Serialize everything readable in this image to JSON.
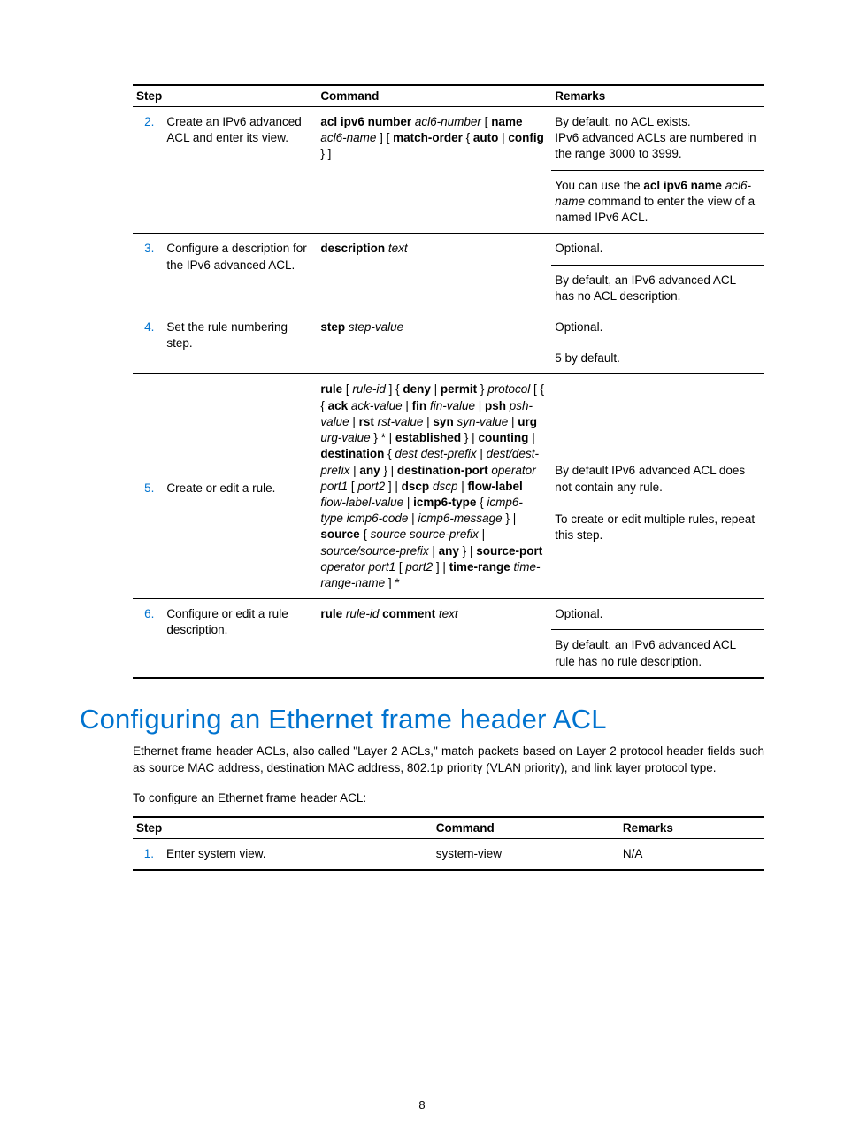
{
  "table1": {
    "headers": {
      "step": "Step",
      "command": "Command",
      "remarks": "Remarks"
    },
    "rows": [
      {
        "num": "2.",
        "step": "Create an IPv6 advanced ACL and enter its view.",
        "command_html": "<span class='b'>acl ipv6 number</span> <span class='i'>acl6-number</span> [ <span class='b'>name</span> <span class='i'>acl6-name</span> ] [ <span class='b'>match-order</span> { <span class='b'>auto</span> | <span class='b'>config</span> } ]",
        "remarks_html": [
          "By default, no ACL exists.<br>IPv6 advanced ACLs are numbered in the range 3000 to 3999.",
          "You can use the <span class='b'>acl ipv6 name</span> <span class='i'>acl6-name</span> command to enter the view of a named IPv6 ACL."
        ]
      },
      {
        "num": "3.",
        "step": "Configure a description for the IPv6 advanced ACL.",
        "command_html": "<span class='b'>description</span> <span class='i'>text</span>",
        "remarks_html": [
          "Optional.",
          "By default, an IPv6 advanced ACL has no ACL description."
        ]
      },
      {
        "num": "4.",
        "step": "Set the rule numbering step.",
        "command_html": "<span class='b'>step</span> <span class='i'>step-value</span>",
        "remarks_html": [
          "Optional.",
          "5 by default."
        ]
      },
      {
        "num": "5.",
        "step": "Create or edit a rule.",
        "command_html": "<span class='b'>rule</span> [ <span class='i'>rule-id</span> ] { <span class='b'>deny</span> | <span class='b'>permit</span> } <span class='i'>protocol</span> [ { { <span class='b'>ack</span> <span class='i'>ack-value</span> | <span class='b'>fin</span> <span class='i'>fin-value</span> | <span class='b'>psh</span> <span class='i'>psh-value</span> | <span class='b'>rst</span> <span class='i'>rst-value</span> | <span class='b'>syn</span> <span class='i'>syn-value</span> | <span class='b'>urg</span> <span class='i'>urg-value</span> } * | <span class='b'>established</span> } | <span class='b'>counting</span> | <span class='b'>destination</span> { <span class='i'>dest dest-prefix</span> | <span class='i'>dest/dest-prefix</span> | <span class='b'>any</span> } | <span class='b'>destination-port</span> <span class='i'>operator port1</span> [ <span class='i'>port2</span> ] | <span class='b'>dscp</span> <span class='i'>dscp</span> | <span class='b'>flow-label</span> <span class='i'>flow-label-value</span> | <span class='b'>icmp6-type</span> { <span class='i'>icmp6-type icmp6-code</span> | <span class='i'>icmp6-message</span> } | <span class='b'>source</span> { <span class='i'>source source-prefix</span> | <span class='i'>source/source-prefix</span> | <span class='b'>any</span> } | <span class='b'>source-port</span> <span class='i'>operator port1</span> [ <span class='i'>port2</span> ] | <span class='b'>time-range</span> <span class='i'>time-range-name</span> ] *",
        "remarks_html": [
          "By default IPv6 advanced ACL does not contain any rule.<br><br>To create or edit multiple rules, repeat this step."
        ]
      },
      {
        "num": "6.",
        "step": "Configure or edit a rule description.",
        "command_html": "<span class='b'>rule</span> <span class='i'>rule-id</span> <span class='b'>comment</span> <span class='i'>text</span>",
        "remarks_html": [
          "Optional.",
          "By default, an IPv6 advanced ACL rule has no rule description."
        ]
      }
    ]
  },
  "section": {
    "heading": "Configuring an Ethernet frame header ACL",
    "para1": "Ethernet frame header ACLs, also called \"Layer 2 ACLs,\" match packets based on Layer 2 protocol header fields such as source MAC address, destination MAC address, 802.1p priority (VLAN priority), and link layer protocol type.",
    "para2": "To configure an Ethernet frame header ACL:"
  },
  "table2": {
    "headers": {
      "step": "Step",
      "command": "Command",
      "remarks": "Remarks"
    },
    "rows": [
      {
        "num": "1.",
        "step": "Enter system view.",
        "command": "system-view",
        "remarks": "N/A"
      }
    ]
  },
  "page_number": "8"
}
